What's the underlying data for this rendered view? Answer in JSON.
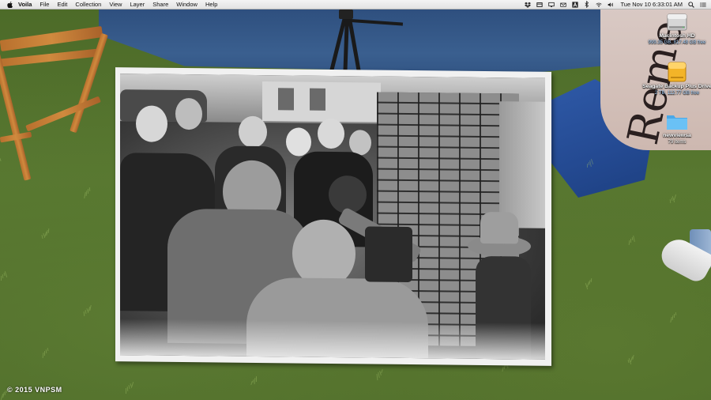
{
  "menubar": {
    "app_name": "Voila",
    "items": [
      "File",
      "Edit",
      "Collection",
      "View",
      "Layer",
      "Share",
      "Window",
      "Help"
    ],
    "status_icons": [
      "dropbox-icon",
      "box-icon",
      "display-icon",
      "mail-icon",
      "adobe-icon",
      "bluetooth-icon",
      "wifi-icon",
      "volume-icon"
    ],
    "clock": "Tue Nov 10  6:33:01 AM"
  },
  "desktop_icons": [
    {
      "name": "Macintosh HD",
      "detail": "999.35 GB, 817.48 GB free",
      "icon": "hard-drive-icon"
    },
    {
      "name": "Seagate Backup Plus Drive",
      "detail": "2 TB, 112.77 GB free",
      "icon": "external-drive-icon"
    },
    {
      "name": "newviewsa",
      "detail": "79 items",
      "icon": "folder-icon"
    }
  ],
  "wallpaper": {
    "banner_text": "Reme",
    "watermark": "© 2015 VNPSM"
  },
  "colors": {
    "folder": "#5fb6ef",
    "external_drive": "#f3b428",
    "hard_drive": "#c9c9c9"
  }
}
